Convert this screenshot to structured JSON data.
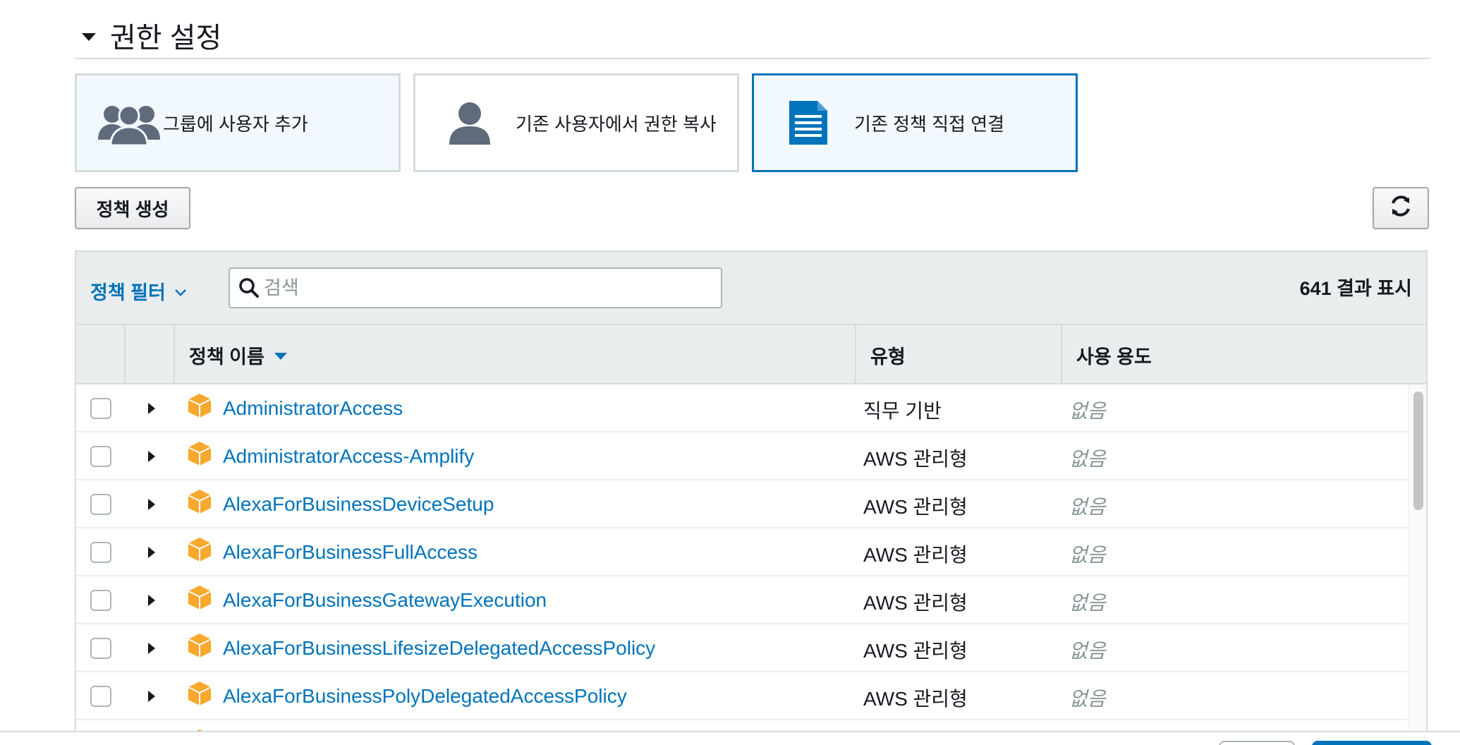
{
  "section": {
    "title": "권한 설정"
  },
  "options": [
    {
      "label": "그룹에 사용자 추가",
      "icon": "users-group-icon",
      "state": "light"
    },
    {
      "label": "기존 사용자에서 권한 복사",
      "icon": "user-icon",
      "state": "normal"
    },
    {
      "label": "기존 정책 직접 연결",
      "icon": "document-icon",
      "state": "selected"
    }
  ],
  "toolbar": {
    "create_policy_label": "정책 생성",
    "refresh_icon": "refresh-icon"
  },
  "filter": {
    "label": "정책 필터",
    "search_placeholder": "검색",
    "result_count": "641 결과 표시"
  },
  "table": {
    "columns": {
      "name": "정책 이름",
      "type": "유형",
      "usage": "사용 용도"
    },
    "sort_column": "name",
    "rows": [
      {
        "name": "AdministratorAccess",
        "type": "직무 기반",
        "usage": "없음"
      },
      {
        "name": "AdministratorAccess-Amplify",
        "type": "AWS 관리형",
        "usage": "없음"
      },
      {
        "name": "AlexaForBusinessDeviceSetup",
        "type": "AWS 관리형",
        "usage": "없음"
      },
      {
        "name": "AlexaForBusinessFullAccess",
        "type": "AWS 관리형",
        "usage": "없음"
      },
      {
        "name": "AlexaForBusinessGatewayExecution",
        "type": "AWS 관리형",
        "usage": "없음"
      },
      {
        "name": "AlexaForBusinessLifesizeDelegatedAccessPolicy",
        "type": "AWS 관리형",
        "usage": "없음"
      },
      {
        "name": "AlexaForBusinessPolyDelegatedAccessPolicy",
        "type": "AWS 관리형",
        "usage": "없음"
      }
    ]
  },
  "colors": {
    "accent": "#0073bb",
    "selected_bg": "#f1f8fe",
    "package_icon": "#f7a82d",
    "header_bg": "#eaeded"
  }
}
